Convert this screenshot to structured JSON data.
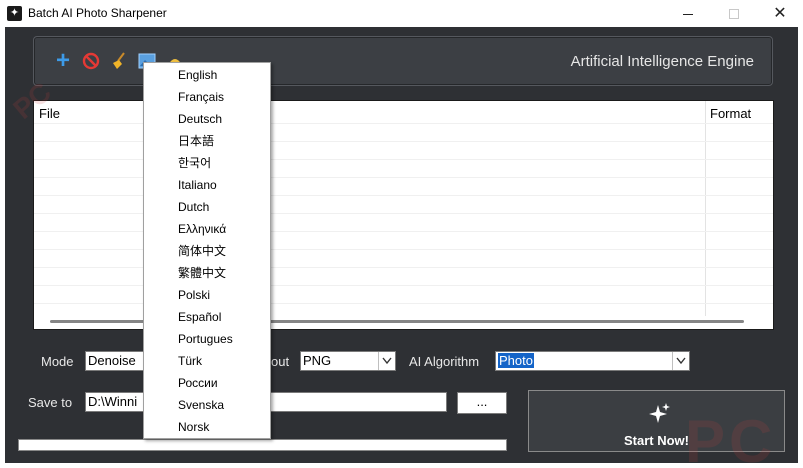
{
  "window": {
    "title": "Batch AI Photo Sharpener",
    "minimize_glyph": "",
    "close_glyph": "✕"
  },
  "toolbar": {
    "engine_label": "Artificial Intelligence Engine",
    "icons": [
      "add-icon",
      "remove-icon",
      "clear-icon",
      "image-icon",
      "language-icon"
    ]
  },
  "filelist": {
    "columns": [
      "File",
      "Format"
    ]
  },
  "controls": {
    "mode_label": "Mode",
    "mode_value": "Denoise",
    "output_label_partial": "out",
    "output_value": "PNG",
    "algorithm_label": "AI Algorithm",
    "algorithm_value": "Photo",
    "save_to_label": "Save to",
    "save_to_value": "D:\\Winni",
    "browse_label": "...",
    "start_label": "Start Now!"
  },
  "language_menu": {
    "items": [
      "English",
      "Français",
      "Deutsch",
      "日本語",
      "한국어",
      "Italiano",
      "Dutch",
      "Ελληνικά",
      "简体中文",
      "繁體中文",
      "Polski",
      "Español",
      "Portugues",
      "Türk",
      "России",
      "Svenska",
      "Norsk"
    ]
  },
  "watermark": {
    "text_br": "PC",
    "text_tl": "PC"
  },
  "colors": {
    "client_bg": "#2e3034",
    "accent_selection": "#1464c8",
    "add_icon": "#3d9be9"
  }
}
